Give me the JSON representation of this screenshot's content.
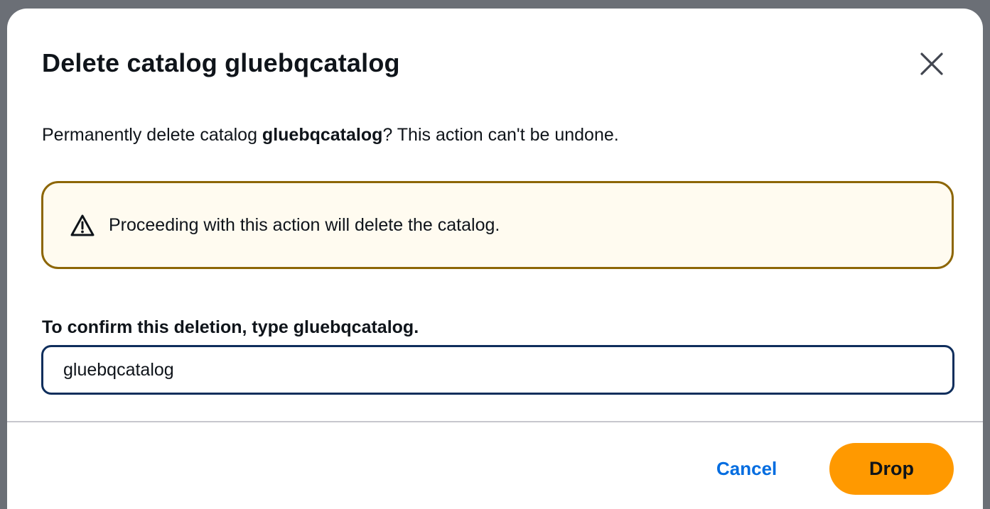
{
  "modal": {
    "title": "Delete catalog gluebqcatalog",
    "close_icon": "close-icon",
    "description": {
      "prefix": "Permanently delete catalog ",
      "catalog_name": "gluebqcatalog",
      "suffix": "? This action can't be undone."
    },
    "warning": {
      "icon": "warning-icon",
      "text": "Proceeding with this action will delete the catalog."
    },
    "confirm": {
      "label_prefix": "To confirm this deletion, type ",
      "label_name": "gluebqcatalog",
      "label_suffix": ".",
      "input_value": "gluebqcatalog"
    },
    "footer": {
      "cancel_label": "Cancel",
      "drop_label": "Drop"
    }
  },
  "colors": {
    "warning_border": "#8d6605",
    "warning_background": "#fffbf0",
    "primary_button": "#ff9900",
    "link_button": "#006ce0",
    "input_border_focused": "#0f2e5c"
  }
}
